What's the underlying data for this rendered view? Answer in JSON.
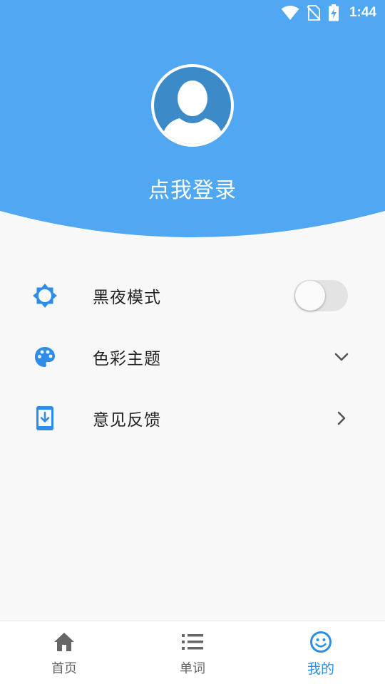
{
  "status_bar": {
    "time": "1:44",
    "icons": [
      "wifi-icon",
      "no-sim-icon",
      "battery-charging-icon"
    ]
  },
  "profile": {
    "avatar_icon": "user-silhouette-icon",
    "login_text": "点我登录"
  },
  "colors": {
    "header_blue": "#4fa8f1",
    "accent_blue": "#2a8fe6",
    "icon_blue": "#2d8de8",
    "background": "#f8f8f8"
  },
  "menu": {
    "items": [
      {
        "label": "黑夜模式",
        "icon": "brightness-icon",
        "trailing": "toggle",
        "toggle_on": false
      },
      {
        "label": "色彩主题",
        "icon": "palette-icon",
        "trailing": "chevron-down-icon"
      },
      {
        "label": "意见反馈",
        "icon": "phone-download-icon",
        "trailing": "chevron-right-icon"
      }
    ]
  },
  "bottom_nav": {
    "items": [
      {
        "label": "首页",
        "icon": "home-icon",
        "active": false
      },
      {
        "label": "单词",
        "icon": "list-icon",
        "active": false
      },
      {
        "label": "我的",
        "icon": "smiley-icon",
        "active": true
      }
    ]
  }
}
